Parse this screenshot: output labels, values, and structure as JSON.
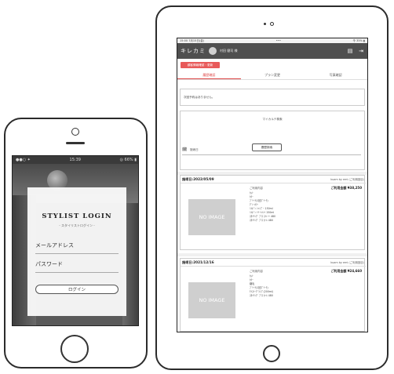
{
  "phone": {
    "status_left": "●●○ ✦",
    "status_time": "15:39",
    "status_right": "◎ 66% ▮",
    "login_title": "STYLIST LOGIN",
    "login_subtitle": "- スタイリストログイン -",
    "email_label": "メールアドレス",
    "password_label": "パスワード",
    "login_button": "ログイン"
  },
  "tablet": {
    "status_left": "15:00  7月15日(金)",
    "status_center": "•••",
    "status_right": "令 35% ▮",
    "logo": "キレカミ",
    "user_name": "村田 健司 様",
    "red_button": "顧客情報確認・更新",
    "tabs": [
      "履歴確認",
      "プラン変更",
      "写真確認"
    ],
    "no_reservation": "次回予約はありません。",
    "karte_title": "マイカルテ検索",
    "date_placeholder": "施術日",
    "search_button": "履歴検索",
    "cards": [
      {
        "date": "施術日:2022/05/09",
        "shop": "kuam by emi (ご利用回目)",
        "detail_label": "ご利用内容",
        "price": "ご利用金額 ¥38,250",
        "image_label": "NO IMAGE",
        "lines": [
          "ｶｯﾄ",
          "ｶﾗｰ",
          "ﾌﾞﾘｰﾁ(1回ﾌﾞﾘｰﾁ)",
          "ｸﾞﾚｰｶﾗｰ",
          "ﾐﾙﾎﾞﾝ ｼｬﾝﾌﾟｰ 150ml",
          "ﾐﾙﾎﾞﾝ ﾄﾘｰﾄﾒﾝﾄ 150ml",
          "ｽﾀｲﾘﾝｸﾞ ﾌﾟﾛ ｽﾄﾚｰﾄ 480",
          "ｽﾀｲﾘﾝｸﾞ ﾌﾟﾛ ｶｰﾙ 480"
        ]
      },
      {
        "date": "施術日:2021/12/16",
        "shop": "kuam by emi (ご利用回目)",
        "detail_label": "ご利用内容",
        "price": "ご利用金額 ¥24,660",
        "image_label": "NO IMAGE",
        "lines": [
          "ｶｯﾄ",
          "ｶﾗｰ",
          "縮毛",
          "ﾌﾞﾘｰﾁ(1回ﾌﾞﾘｰﾁ)",
          "ﾓｲｽﾄｰｸﾞﾗﾝﾌﾟ(200ml)",
          "ｽﾀｲﾘﾝｸﾞ ﾌﾟﾛ ｶｰﾙ 480"
        ]
      }
    ]
  }
}
